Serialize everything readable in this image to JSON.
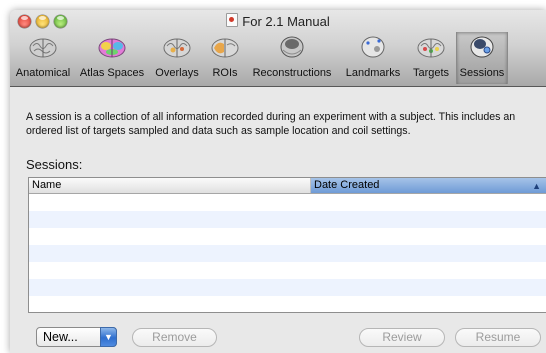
{
  "window": {
    "title": "For 2.1 Manual"
  },
  "toolbar": {
    "items": [
      {
        "label": "Anatomical",
        "icon": "brain-gray-icon",
        "selected": false
      },
      {
        "label": "Atlas Spaces",
        "icon": "brain-color-icon",
        "selected": false
      },
      {
        "label": "Overlays",
        "icon": "brain-overlay-icon",
        "selected": false
      },
      {
        "label": "ROIs",
        "icon": "brain-roi-icon",
        "selected": false
      },
      {
        "label": "Reconstructions",
        "icon": "head-reconstruction-icon",
        "selected": false
      },
      {
        "label": "Landmarks",
        "icon": "head-landmarks-icon",
        "selected": false
      },
      {
        "label": "Targets",
        "icon": "brain-targets-icon",
        "selected": false
      },
      {
        "label": "Sessions",
        "icon": "head-sessions-icon",
        "selected": true
      }
    ]
  },
  "content": {
    "description": "A session is a collection of all information recorded during an experiment with a subject. This includes an ordered list of targets sampled and data such as sample location and coil settings.",
    "sessions_label": "Sessions:",
    "table": {
      "columns": [
        "Name",
        "Date Created"
      ],
      "sorted_column": "Date Created",
      "sort_direction": "ascending",
      "rows": []
    }
  },
  "buttons": {
    "new_label": "New...",
    "remove_label": "Remove",
    "review_label": "Review",
    "resume_label": "Resume"
  },
  "colors": {
    "selection_header": "#7fa6dc",
    "alternate_row": "#edf3fe",
    "popup_arrow": "#3b7bd8"
  }
}
